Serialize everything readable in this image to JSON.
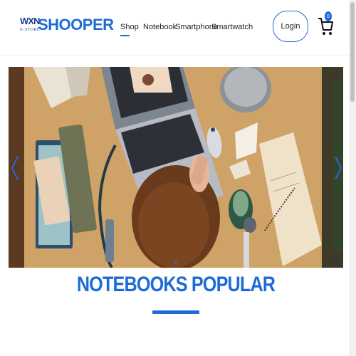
{
  "header": {
    "logo_mark": "WXN",
    "logo_sub": "E-STORE",
    "logo_text": "SHOOPER",
    "nav": [
      {
        "label": "Shop",
        "active": true
      },
      {
        "label": "Notebook"
      },
      {
        "label": "Smartphone"
      },
      {
        "label": "Smartwatch"
      }
    ],
    "login_label": "Login",
    "cart_count": "0"
  },
  "hero": {
    "prev_icon": "chevron-left-icon",
    "next_icon": "chevron-right-icon"
  },
  "section": {
    "title": "NOTEBOOKS POPULAR"
  },
  "colors": {
    "accent": "#1f6bd6",
    "login_border": "#2b65d9",
    "text": "#1b1f2a"
  }
}
